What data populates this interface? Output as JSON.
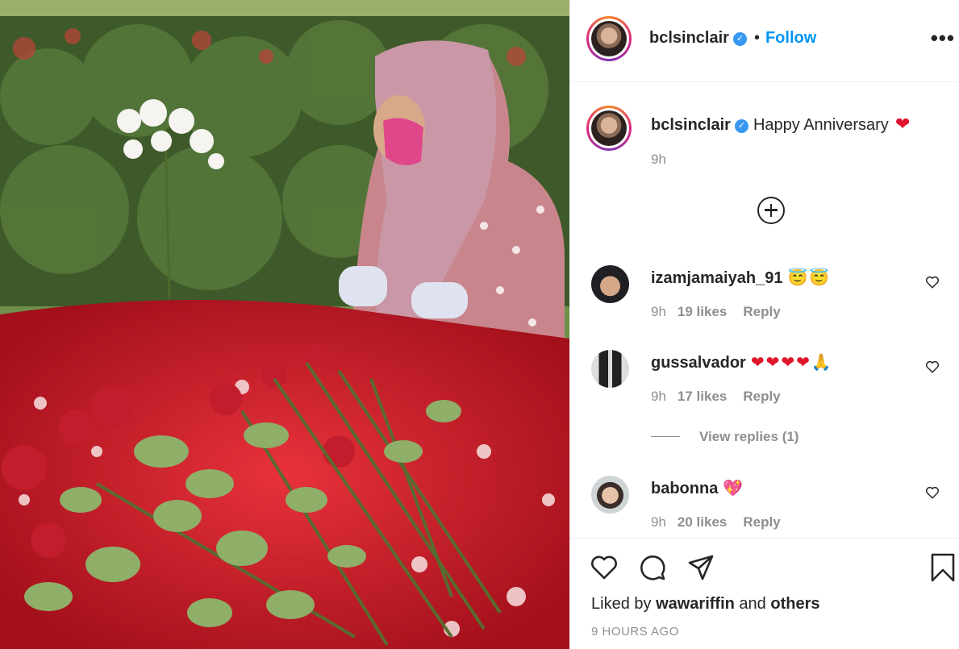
{
  "post": {
    "username": "bclsinclair",
    "follow_label": "Follow",
    "dot": "•",
    "more_label": "•••",
    "verified_mark": "✓",
    "caption": "Happy Anniversary",
    "caption_emoji": "❤",
    "caption_time": "9h",
    "liked_prefix": "Liked by",
    "liked_user": "wawariffin",
    "liked_and": "and",
    "liked_others": "others",
    "time_ago": "9 HOURS AGO"
  },
  "comments": [
    {
      "username": "izamjamaiyah_91",
      "emoji": "😇😇",
      "time": "9h",
      "likes": "19 likes",
      "reply": "Reply"
    },
    {
      "username": "gussalvador",
      "emoji": "❤❤❤❤🙏",
      "time": "9h",
      "likes": "17 likes",
      "reply": "Reply"
    },
    {
      "username": "babonna",
      "emoji": "💖",
      "time": "9h",
      "likes": "20 likes",
      "reply": "Reply"
    }
  ],
  "view_replies": "View replies (1)",
  "icons": [
    "heart-icon",
    "comment-icon",
    "share-icon",
    "bookmark-icon",
    "add-comment-icon",
    "more-options-icon"
  ],
  "colors": {
    "accent": "#0095f6",
    "text": "#262626",
    "muted": "#8e8e8e",
    "heart": "#e0142c"
  }
}
